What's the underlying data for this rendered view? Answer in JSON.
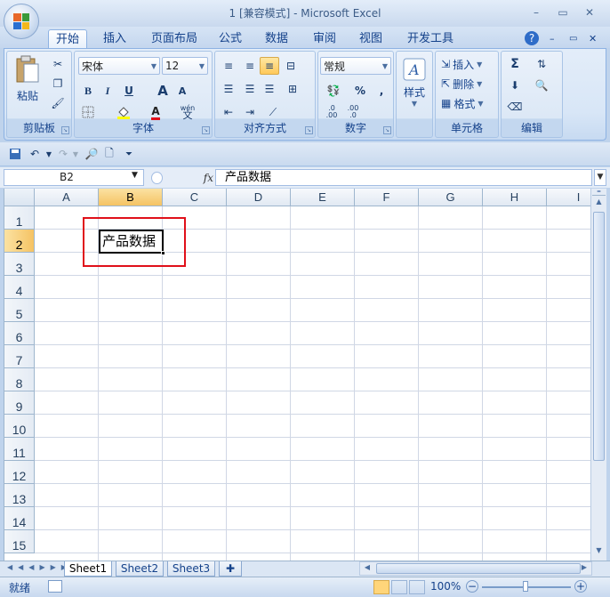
{
  "window": {
    "title": "1  [兼容模式] - Microsoft Excel",
    "minimize": "–",
    "restore": "▭",
    "close": "✕"
  },
  "ribbon_tabs": [
    "开始",
    "插入",
    "页面布局",
    "公式",
    "数据",
    "审阅",
    "视图",
    "开发工具"
  ],
  "ribbon_right": {
    "help": "?",
    "min": "–",
    "restore": "▭",
    "close": "✕"
  },
  "clipboard": {
    "paste": "粘贴",
    "label": "剪贴板"
  },
  "font": {
    "name": "宋体",
    "size": "12",
    "bold": "B",
    "italic": "I",
    "underline": "U",
    "grow": "A",
    "shrink": "A",
    "wen": "wén",
    "wen_char": "文",
    "label": "字体"
  },
  "alignment": {
    "label": "对齐方式"
  },
  "number": {
    "format": "常规",
    "percent": "%",
    "comma": ",",
    "inc": ".0",
    "dec": ".00",
    "inc2": ".00",
    "dec2": ".0",
    "label": "数字"
  },
  "styles": {
    "label": "样式"
  },
  "cells": {
    "insert": "插入",
    "delete": "删除",
    "format": "格式",
    "label": "单元格"
  },
  "editing": {
    "sum": "Σ",
    "label": "编辑"
  },
  "formula_bar": {
    "name_box": "B2",
    "fx": "fx",
    "value": "产品数据"
  },
  "columns": [
    "A",
    "B",
    "C",
    "D",
    "E",
    "F",
    "G",
    "H",
    "I"
  ],
  "rows": [
    "1",
    "2",
    "3",
    "4",
    "5",
    "6",
    "7",
    "8",
    "9",
    "10",
    "11",
    "12",
    "13",
    "14",
    "15"
  ],
  "active_cell": {
    "ref": "B2",
    "value": "产品数据"
  },
  "sheets": [
    "Sheet1",
    "Sheet2",
    "Sheet3"
  ],
  "status": {
    "ready": "就绪",
    "zoom": "100%"
  },
  "colors": {
    "highlight": "#e0101a",
    "font_color": "#e0101a",
    "fill_color": "#ffff00"
  }
}
